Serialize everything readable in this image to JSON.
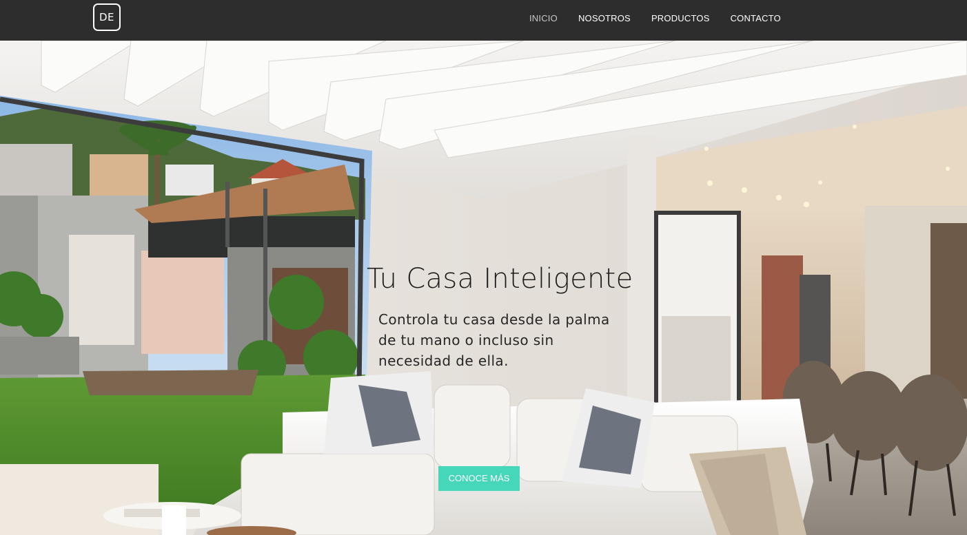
{
  "logo": {
    "text": "DE"
  },
  "nav": {
    "items": [
      {
        "label": "INICIO",
        "active": true
      },
      {
        "label": "NOSOTROS",
        "active": false
      },
      {
        "label": "PRODUCTOS",
        "active": false
      },
      {
        "label": "CONTACTO",
        "active": false
      }
    ]
  },
  "hero": {
    "title": "Tu Casa Inteligente",
    "subtitle": "Controla tu casa desde la palma de tu mano o incluso sin necesidad de ella.",
    "cta_label": "CONOCE MÁS"
  },
  "colors": {
    "header_bg": "#2d2d2d",
    "nav_text": "#ffffff",
    "nav_active": "#c8c8c8",
    "cta_bg": "#46d6b9"
  }
}
